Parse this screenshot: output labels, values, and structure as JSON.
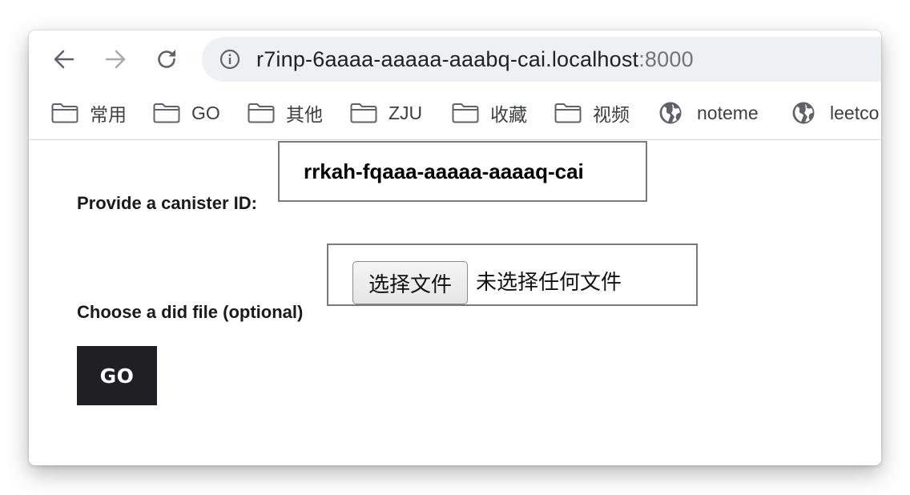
{
  "browser": {
    "address_bar": {
      "url_host": "r7inp-6aaaa-aaaaa-aaabq-cai.localhost",
      "url_port": ":8000",
      "info_icon": "info-circle-icon"
    },
    "nav": {
      "back_icon": "arrow-left-icon",
      "forward_icon": "arrow-right-icon",
      "reload_icon": "reload-icon"
    },
    "bookmarks": [
      {
        "label": "常用",
        "icon": "folder-icon"
      },
      {
        "label": "GO",
        "icon": "folder-icon"
      },
      {
        "label": "其他",
        "icon": "folder-icon"
      },
      {
        "label": "ZJU",
        "icon": "folder-icon"
      },
      {
        "label": "收藏",
        "icon": "folder-icon"
      },
      {
        "label": "视频",
        "icon": "folder-icon"
      },
      {
        "label": "noteme",
        "icon": "globe-icon"
      },
      {
        "label": "leetco",
        "icon": "globe-icon"
      }
    ]
  },
  "form": {
    "canister_label": "Provide a canister ID:",
    "canister_value": "rrkah-fqaaa-aaaaa-aaaaq-cai",
    "did_label": "Choose a did file (optional)",
    "file_button_label": "选择文件",
    "file_status": "未选择任何文件",
    "go_label": "GO"
  },
  "colors": {
    "go_button_bg": "#1f1f24",
    "omnibox_bg": "#eef1f4",
    "input_border": "#7a7a7a"
  }
}
